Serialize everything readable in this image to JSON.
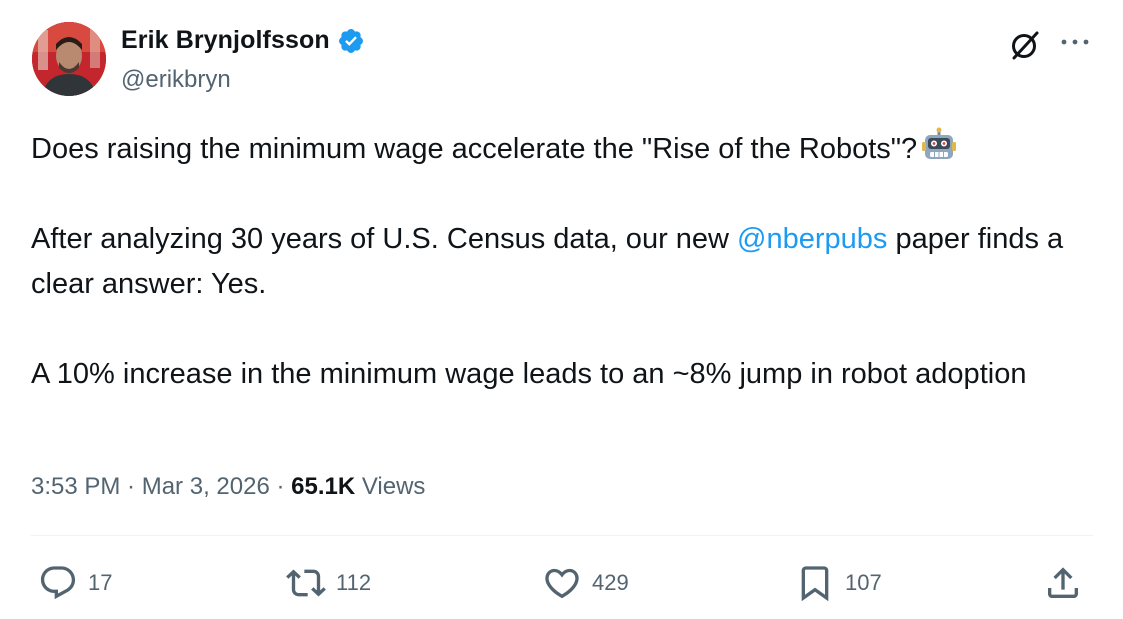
{
  "author": {
    "display_name": "Erik Brynjolfsson",
    "handle": "@erikbryn",
    "verified": true
  },
  "tweet": {
    "line1": "Does raising the minimum wage accelerate the \"Rise of the Robots\"?",
    "line1_emoji": "robot-face",
    "para2_before": "After analyzing 30 years of U.S. Census data, our new ",
    "para2_mention": "@nberpubs",
    "para2_after": " paper finds a clear answer: Yes.",
    "para3": "A 10% increase in the minimum wage leads to an ~8% jump in robot adoption"
  },
  "meta": {
    "time": "3:53 PM",
    "separator1": " · ",
    "date": "Mar 3, 2026",
    "separator2": " · ",
    "views_count": "65.1K",
    "views_label": " Views"
  },
  "actions": {
    "replies": "17",
    "reposts": "112",
    "likes": "429",
    "bookmarks": "107"
  },
  "colors": {
    "text": "#0f1419",
    "secondary": "#536471",
    "accent": "#1d9bf0",
    "divider": "#eff3f4"
  }
}
